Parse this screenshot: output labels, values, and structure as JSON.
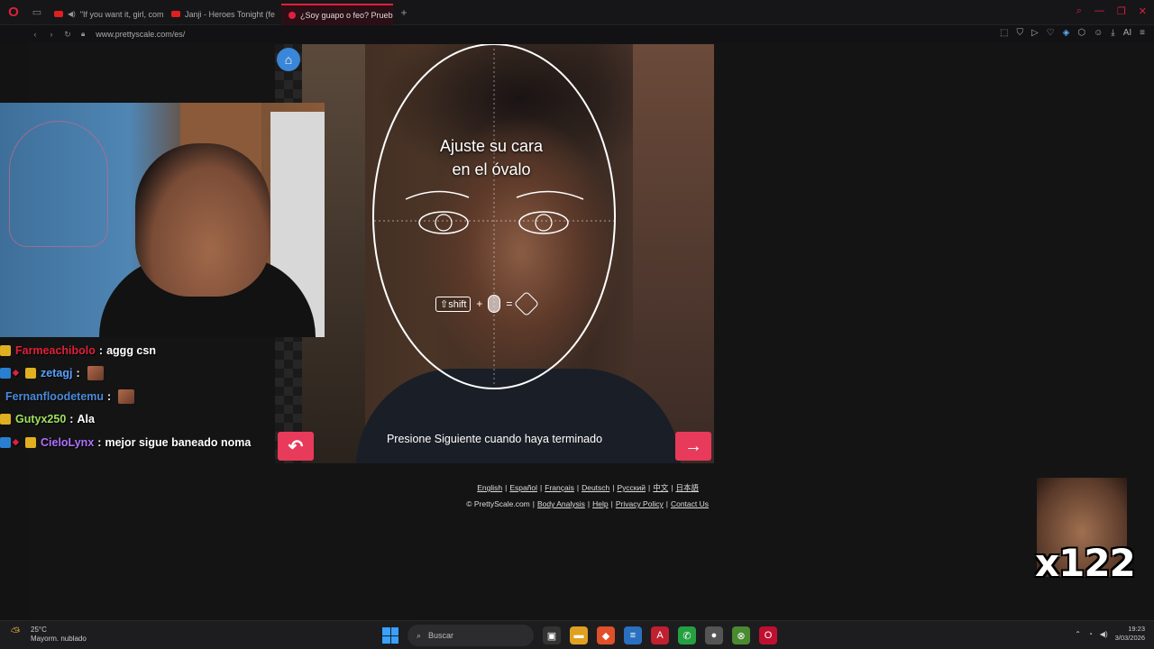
{
  "browser": {
    "tabs": [
      {
        "title": "\"If you want it, girl, com",
        "kind": "youtube",
        "muted": true
      },
      {
        "title": "Janji - Heroes Tonight (fe",
        "kind": "youtube",
        "muted": false
      },
      {
        "title": "¿Soy guapo o feo? Prueba",
        "kind": "site",
        "muted": false,
        "active": true
      }
    ],
    "url": "www.prettyscale.com/es/",
    "ai_label": "AI"
  },
  "app": {
    "instruction_line1": "Ajuste su cara",
    "instruction_line2": "en el óvalo",
    "shift_key": "⇧shift",
    "plus": "+",
    "equals": "=",
    "next_hint": "Presione Siguiente cuando haya terminado",
    "back_icon": "undo-arrow-icon",
    "next_icon": "right-arrow-icon",
    "accent_color": "#e83a5a",
    "home_color": "#3a86d8"
  },
  "footer": {
    "languages": [
      "English",
      "Español",
      "Français",
      "Deutsch",
      "Русский",
      "中文",
      "日本語"
    ],
    "copyright": "© PrettyScale.com",
    "links": [
      "Body Analysis",
      "Help",
      "Privacy Policy",
      "Contact Us"
    ]
  },
  "chat": [
    {
      "user": "Farmeachibolo",
      "color": "#e0203c",
      "badges": [
        "crown"
      ],
      "message": "aggg csn",
      "emote": false
    },
    {
      "user": "zetagj",
      "color": "#5aa0ff",
      "badges": [
        "prime",
        "lock",
        "crown"
      ],
      "message": "",
      "emote": true
    },
    {
      "user": "Fernanfloodetemu",
      "color": "#4a8ad8",
      "badges": [],
      "message": "",
      "emote": true
    },
    {
      "user": "Gutyx250",
      "color": "#a0e060",
      "badges": [
        "crown"
      ],
      "message": "Ala",
      "emote": false
    },
    {
      "user": "CieloLynx",
      "color": "#b070ff",
      "badges": [
        "prime",
        "lock",
        "crown"
      ],
      "message": "mejor sigue baneado noma",
      "emote": false
    }
  ],
  "meme": {
    "count": "x122"
  },
  "taskbar": {
    "temperature": "25°C",
    "weather": "Mayorm. nublado",
    "search_placeholder": "Buscar",
    "time": "19:23",
    "date": "3/03/2026"
  }
}
